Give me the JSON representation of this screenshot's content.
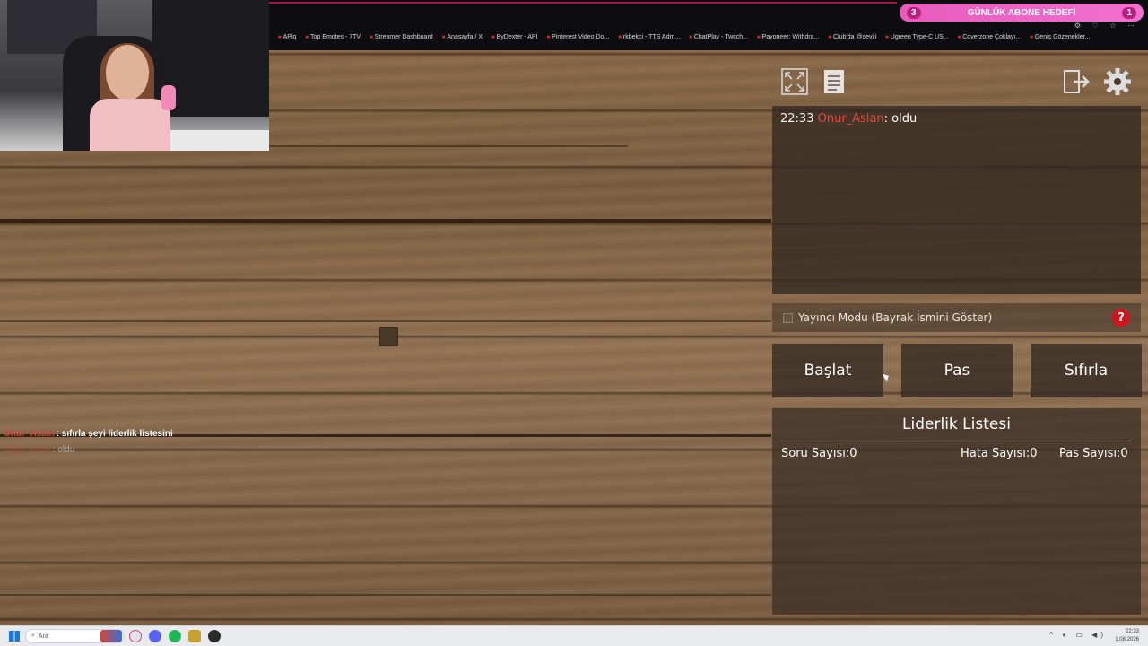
{
  "browser": {
    "bookmarks": [
      "APlq",
      "Top Emotes - 7TV",
      "Streamer Dashboard",
      "Anasayfa / X",
      "ByDexter - API",
      "Pinterest Video Do...",
      "rkbekci - TTS Adm...",
      "ChatPlay - Twitch...",
      "Payoneer: Withdra...",
      "Club'da @sevili",
      "Ugreen Type-C US...",
      "Coverzone Çoklayı...",
      "Geniş Gözenekler..."
    ]
  },
  "goal": {
    "left": "3",
    "label": "GÜNLÜK ABONE HEDEFİ",
    "right": "1"
  },
  "chat_overlay": [
    {
      "user": "Onur_Aslan",
      "text": ": sıfırla şeyi liderlik listesini"
    },
    {
      "user": "Onur_Aslan",
      "text": ": oldu"
    }
  ],
  "panel": {
    "icons": [
      "fullscreen-icon",
      "notes-icon",
      "exit-icon",
      "settings-gear-icon"
    ],
    "message": {
      "time": "22:33",
      "user": "Onur_Aslan",
      "text": ": oldu"
    },
    "mode_label": "Yayıncı Modu (Bayrak İsmini Göster)",
    "help_label": "?",
    "buttons": {
      "start": "Başlat",
      "pass": "Pas",
      "reset": "Sıfırla"
    },
    "leaderboard": {
      "title": "Liderlik Listesi",
      "questions": "Soru Sayısı:0",
      "errors": "Hata Sayısı:0",
      "passes": "Pas Sayısı:0"
    }
  },
  "taskbar": {
    "search_placeholder": "Ara",
    "time": "22:33",
    "date": "1.08.2026"
  },
  "colors": {
    "username": "#e8463c",
    "goal_pink": "#f26fd0",
    "help_red": "#d4141c"
  }
}
